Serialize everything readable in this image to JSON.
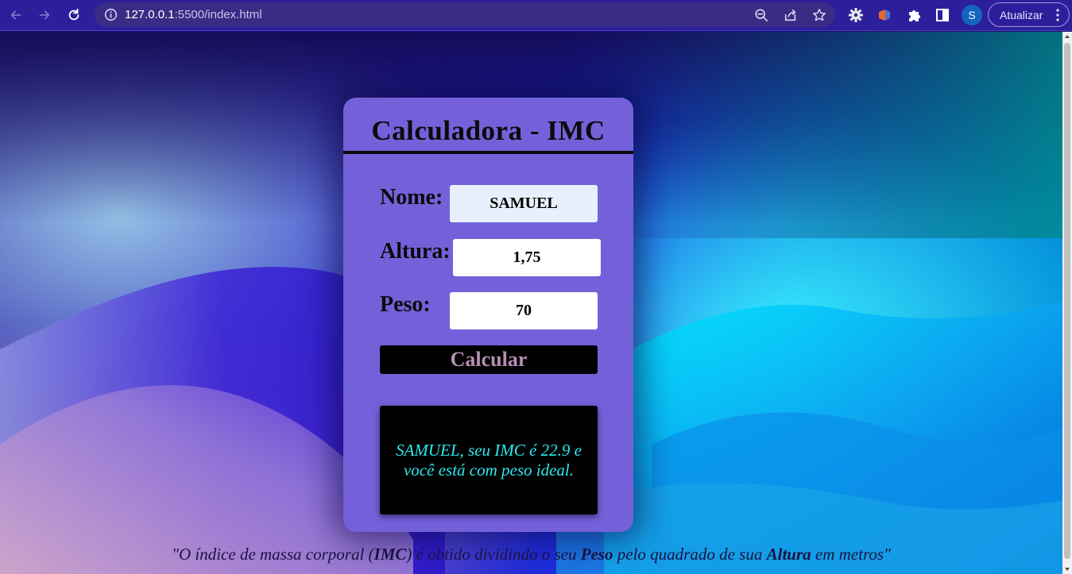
{
  "browser": {
    "url_host": "127.0.0.1",
    "url_rest": ":5500/index.html",
    "update_label": "Atualizar",
    "avatar_initial": "S",
    "accent": "#2d1f9b"
  },
  "card": {
    "title": "Calculadora - IMC",
    "nome_label": "Nome:",
    "nome_value": "SAMUEL",
    "altura_label": "Altura:",
    "altura_value": "1,75",
    "peso_label": "Peso:",
    "peso_value": "70",
    "calc_label": "Calcular",
    "result_text": "SAMUEL, seu IMC é 22.9 e você está com peso ideal.",
    "card_color": "#7461da",
    "result_color": "#2ee8f0"
  },
  "quote": {
    "part1": "\"O índice de massa corporal (",
    "bold1": "IMC",
    "part2": ") é obtido dividindo o seu ",
    "bold2": "Peso",
    "part3": " pelo quadrado de sua ",
    "bold3": "Altura",
    "part4": " em metros\""
  }
}
